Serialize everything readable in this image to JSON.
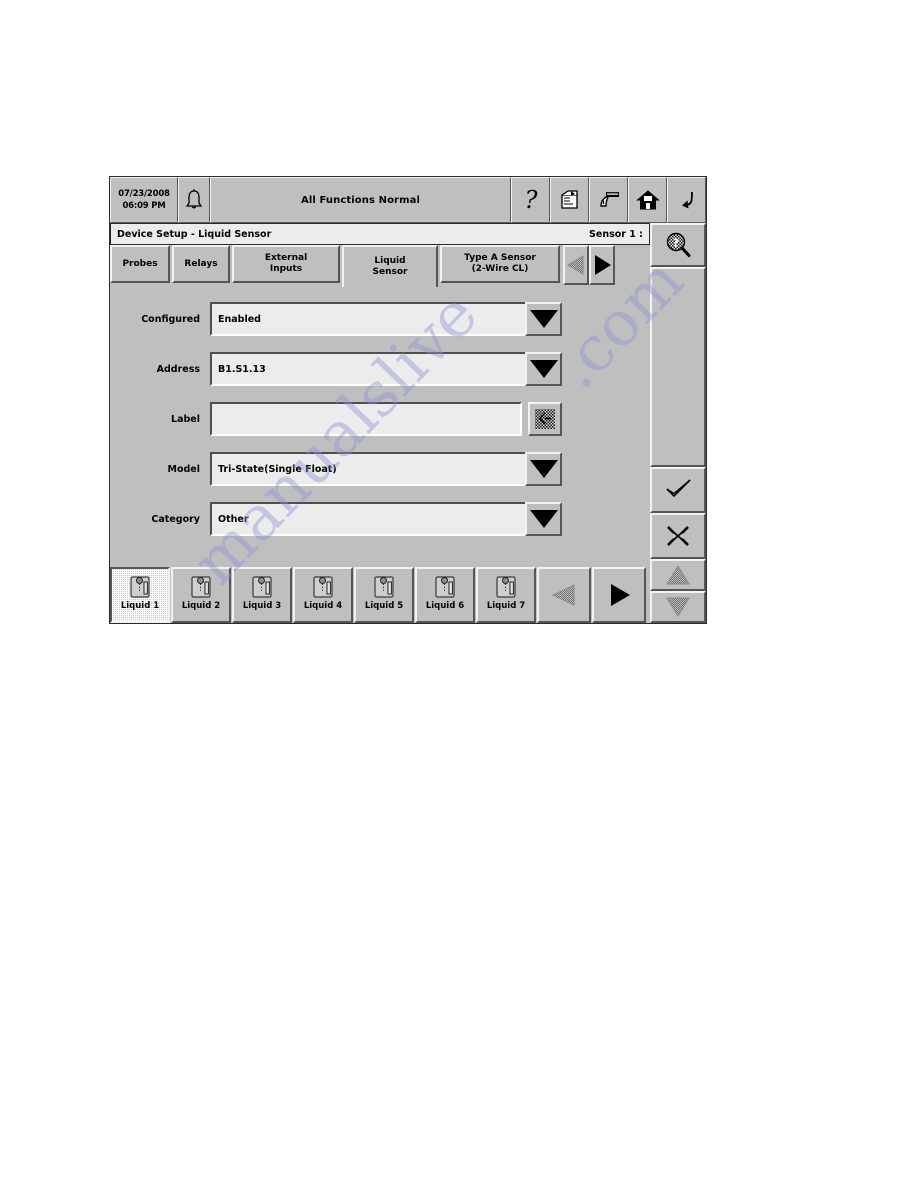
{
  "header": {
    "date": "07/23/2008",
    "time": "06:09 PM",
    "status": "All Functions Normal",
    "alarm_icon": "bell-icon",
    "icons": [
      {
        "name": "help-icon",
        "label": "?"
      },
      {
        "name": "print-icon",
        "label": "print"
      },
      {
        "name": "gauge-icon",
        "label": "gauge"
      },
      {
        "name": "home-icon",
        "label": "home"
      },
      {
        "name": "return-icon",
        "label": "return"
      }
    ]
  },
  "title_row": {
    "page_title": "Device Setup - Liquid Sensor",
    "sensor_label": "Sensor 1 :"
  },
  "tabs": [
    {
      "label": "Probes",
      "name": "tab-probes",
      "selected": false
    },
    {
      "label": "Relays",
      "name": "tab-relays",
      "selected": false
    },
    {
      "label": "External\nInputs",
      "line1": "External",
      "line2": "Inputs",
      "name": "tab-external-inputs",
      "selected": false
    },
    {
      "label": "Liquid\nSensor",
      "line1": "Liquid",
      "line2": "Sensor",
      "name": "tab-liquid-sensor",
      "selected": true
    },
    {
      "label": "Type A Sensor\n(2-Wire CL)",
      "line1": "Type A Sensor",
      "line2": "(2-Wire CL)",
      "name": "tab-type-a-sensor",
      "selected": false
    }
  ],
  "tab_nav": {
    "prev_icon": "triangle-left-icon",
    "prev_enabled": false,
    "next_icon": "triangle-right-icon",
    "next_enabled": true
  },
  "form": {
    "fields": [
      {
        "label": "Configured",
        "value": "Enabled",
        "control": "dropdown",
        "name": "configured"
      },
      {
        "label": "Address",
        "value": "B1.S1.13",
        "control": "dropdown",
        "name": "address"
      },
      {
        "label": "Label",
        "value": "",
        "control": "keyboard",
        "name": "label"
      },
      {
        "label": "Model",
        "value": "Tri-State(Single Float)",
        "control": "dropdown",
        "name": "model"
      },
      {
        "label": "Category",
        "value": "Other",
        "control": "dropdown",
        "name": "category"
      }
    ],
    "dropdown_icon": "chevron-down-icon",
    "keyboard_icon": "keyboard-icon"
  },
  "bottom_bar": {
    "buttons": [
      {
        "label": "Liquid 1",
        "name": "liquid-1",
        "selected": true
      },
      {
        "label": "Liquid 2",
        "name": "liquid-2",
        "selected": false
      },
      {
        "label": "Liquid 3",
        "name": "liquid-3",
        "selected": false
      },
      {
        "label": "Liquid 4",
        "name": "liquid-4",
        "selected": false
      },
      {
        "label": "Liquid 5",
        "name": "liquid-5",
        "selected": false
      },
      {
        "label": "Liquid 6",
        "name": "liquid-6",
        "selected": false
      },
      {
        "label": "Liquid 7",
        "name": "liquid-7",
        "selected": false
      }
    ],
    "prev_icon": "triangle-left-icon",
    "prev_enabled": false,
    "next_icon": "triangle-right-icon",
    "next_enabled": true
  },
  "side_rail": {
    "help_icon": "magnifier-question-icon",
    "accept_icon": "checkmark-icon",
    "cancel_icon": "x-cross-icon",
    "scroll_up_icon": "triangle-up-icon",
    "scroll_down_icon": "triangle-down-icon",
    "scroll_up_enabled": false,
    "scroll_down_enabled": false
  },
  "watermark": {
    "line1": "manualslive",
    "line2": ".com"
  },
  "colors": {
    "panel": "#bfbfbf",
    "field": "#ececec",
    "text": "#000000",
    "bevel_light": "#f2f2f2",
    "bevel_dark": "#555555",
    "watermark": "#8f94d4"
  }
}
